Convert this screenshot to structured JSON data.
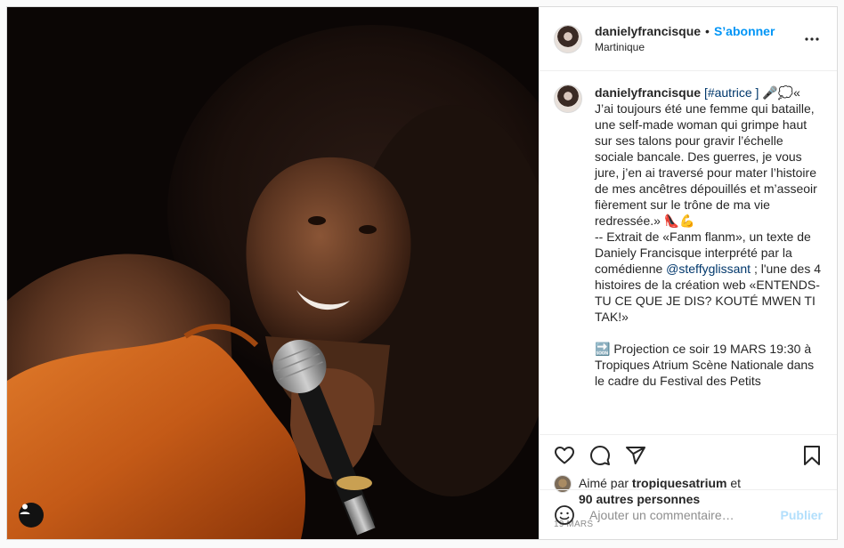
{
  "post": {
    "username": "danielyfrancisque",
    "separator": "•",
    "follow_label": "S’abonner",
    "location": "Martinique",
    "more_icon": "more-horizontal-icon",
    "photo_alt": "",
    "caption": {
      "author": "danielyfrancisque",
      "hashtag": "[#autrice ]",
      "intro_emoji": " 🎤💭«",
      "text1": "J’ai toujours été une femme qui bataille, une self-made woman qui grimpe haut sur ses talons pour gravir l’échelle sociale bancale. Des guerres, je vous jure, j’en ai traversé pour mater l’histoire de mes ancêtres dépouillés et m’asseoir fièrement sur le trône de ma vie redressée.» 👠💪",
      "text2": "-- Extrait de «Fanm flanm», un texte de Daniely Francisque interprété par la comédienne ",
      "mention": "@steffyglissant",
      "text3": " ; l'une des 4 histoires de la création web «ENTENDS-TU CE QUE JE DIS? KOUTÉ MWEN TI TAK!»",
      "text4": "🔜 Projection ce soir 19 MARS 19:30 à Tropiques Atrium Scène Nationale dans le cadre du Festival des Petits"
    },
    "likes": {
      "prefix": "Aimé par ",
      "by": "tropiquesatrium",
      "and": " et",
      "others": "90 autres personnes"
    },
    "date": "19 MARS",
    "comment_placeholder": "Ajouter un commentaire…",
    "publish_label": "Publier"
  },
  "colors": {
    "accent": "#0095f6",
    "publish_disabled": "#b2dffc",
    "link": "#00376b",
    "muted": "#8e8e8e",
    "border": "#dbdbdb"
  }
}
